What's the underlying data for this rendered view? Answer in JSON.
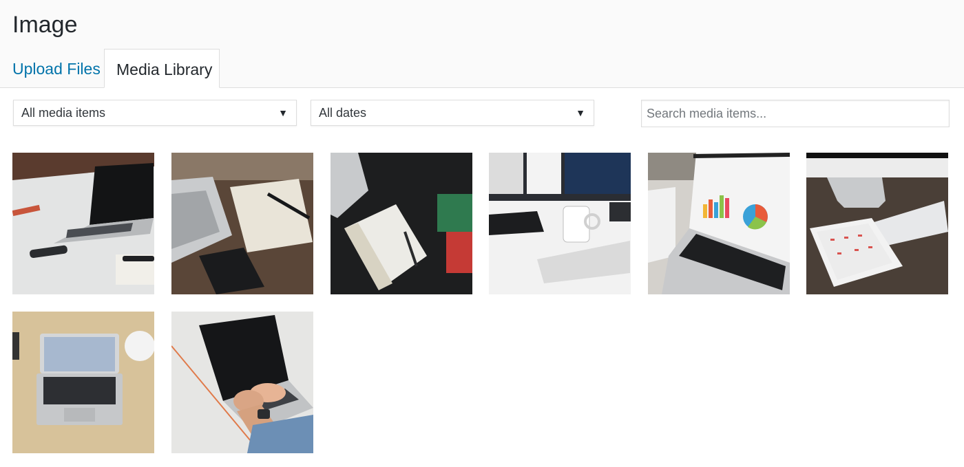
{
  "header": {
    "title": "Image",
    "tabs": [
      {
        "label": "Upload Files",
        "active": false
      },
      {
        "label": "Media Library",
        "active": true
      }
    ]
  },
  "filters": {
    "type_selected": "All media items",
    "date_selected": "All dates",
    "search_placeholder": "Search media items..."
  },
  "media": {
    "items": [
      {
        "depicts": "laptop on white desk"
      },
      {
        "depicts": "notebook and laptop on wooden desk"
      },
      {
        "depicts": "notebook on dark desk"
      },
      {
        "depicts": "mug, monitors and keyboard"
      },
      {
        "depicts": "laptop showing charts"
      },
      {
        "depicts": "imac, keyboard and tablet"
      },
      {
        "depicts": "laptop on beige desk"
      },
      {
        "depicts": "hands typing on laptop"
      }
    ]
  },
  "colors": {
    "link": "#0073aa",
    "header_bg": "#fafafa",
    "border": "#dddddd"
  }
}
